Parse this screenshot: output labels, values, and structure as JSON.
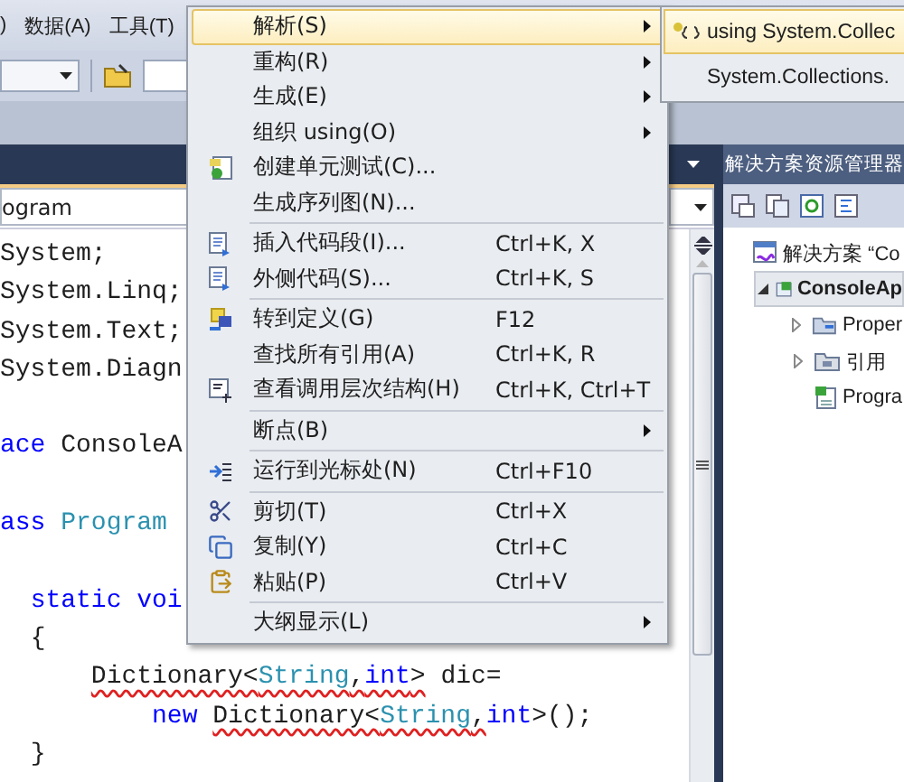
{
  "menu_bar": {
    "items": [
      ")",
      "数据(A)",
      "工具(T)"
    ]
  },
  "editor": {
    "type_dropdown": "ogram",
    "lines": [
      {
        "kind": "code",
        "tokens": [
          {
            "text": "System;",
            "kind": "plain"
          }
        ]
      },
      {
        "kind": "code",
        "tokens": [
          {
            "text": "System.Linq;",
            "kind": "plain"
          }
        ]
      },
      {
        "kind": "code",
        "tokens": [
          {
            "text": "System.Text;",
            "kind": "plain"
          }
        ]
      },
      {
        "kind": "code",
        "tokens": [
          {
            "text": "System.Diagn",
            "kind": "plain"
          }
        ]
      },
      {
        "kind": "blank"
      },
      {
        "kind": "code",
        "tokens": [
          {
            "text": "ace",
            "kind": "keyword"
          },
          {
            "text": " ConsoleA",
            "kind": "plain"
          }
        ]
      },
      {
        "kind": "blank"
      },
      {
        "kind": "code",
        "tokens": [
          {
            "text": "ass",
            "kind": "keyword"
          },
          {
            "text": " Program",
            "kind": "type"
          }
        ]
      },
      {
        "kind": "blank"
      },
      {
        "kind": "code",
        "tokens": [
          {
            "text": "  static voi",
            "kind": "keyword"
          }
        ]
      },
      {
        "kind": "code",
        "tokens": [
          {
            "text": "  {",
            "kind": "plain"
          }
        ]
      },
      {
        "kind": "code",
        "tokens": [
          {
            "text": "      Dictionary<",
            "kind": "plain",
            "error": true
          },
          {
            "text": "String",
            "kind": "type",
            "error": true
          },
          {
            "text": ",",
            "kind": "plain",
            "error": true
          },
          {
            "text": "int",
            "kind": "keyword",
            "error": true
          },
          {
            "text": ">",
            "kind": "plain",
            "error": true
          },
          {
            "text": " dic=",
            "kind": "plain"
          }
        ]
      },
      {
        "kind": "code",
        "tokens": [
          {
            "text": "          new",
            "kind": "keyword"
          },
          {
            "text": " Dictionary<",
            "kind": "plain",
            "error": true
          },
          {
            "text": "String",
            "kind": "type",
            "error": true
          },
          {
            "text": ",",
            "kind": "plain",
            "error": true
          },
          {
            "text": "int",
            "kind": "keyword"
          },
          {
            "text": ">();",
            "kind": "plain"
          }
        ]
      },
      {
        "kind": "code",
        "tokens": [
          {
            "text": "  }",
            "kind": "plain"
          }
        ]
      }
    ]
  },
  "solution_explorer": {
    "title": "解决方案资源管理器",
    "tree": [
      {
        "label": "解决方案 “Co",
        "kind": "solution",
        "selected": false,
        "children": [
          {
            "label": "ConsoleAp",
            "kind": "project",
            "selected": true,
            "expanded": true,
            "children": [
              {
                "label": "Proper",
                "kind": "properties",
                "selected": false,
                "expanded": false
              },
              {
                "label": "引用",
                "kind": "references",
                "selected": false,
                "expanded": false
              },
              {
                "label": "Progra",
                "kind": "file",
                "selected": false
              }
            ]
          }
        ]
      }
    ]
  },
  "context_menu": {
    "groups": [
      [
        {
          "label": "解析(S)",
          "submenu": true,
          "selected": true
        },
        {
          "label": "重构(R)",
          "submenu": true,
          "selected": false
        },
        {
          "label": "生成(E)",
          "submenu": true,
          "selected": false
        },
        {
          "label": "组织 using(O)",
          "submenu": true,
          "selected": false
        },
        {
          "label": "创建单元测试(C)...",
          "selected": false
        },
        {
          "label": "生成序列图(N)...",
          "selected": false
        }
      ],
      [
        {
          "label": "插入代码段(I)...",
          "shortcut": "Ctrl+K, X",
          "selected": false
        },
        {
          "label": "外侧代码(S)...",
          "shortcut": "Ctrl+K, S",
          "selected": false
        }
      ],
      [
        {
          "label": "转到定义(G)",
          "shortcut": "F12",
          "selected": false
        },
        {
          "label": "查找所有引用(A)",
          "shortcut": "Ctrl+K, R",
          "selected": false
        },
        {
          "label": "查看调用层次结构(H)",
          "shortcut": "Ctrl+K, Ctrl+T",
          "selected": false
        }
      ],
      [
        {
          "label": "断点(B)",
          "submenu": true,
          "selected": false
        }
      ],
      [
        {
          "label": "运行到光标处(N)",
          "shortcut": "Ctrl+F10",
          "selected": false
        }
      ],
      [
        {
          "label": "剪切(T)",
          "shortcut": "Ctrl+X",
          "selected": false
        },
        {
          "label": "复制(Y)",
          "shortcut": "Ctrl+C",
          "selected": false
        },
        {
          "label": "粘贴(P)",
          "shortcut": "Ctrl+V",
          "selected": false
        }
      ],
      [
        {
          "label": "大纲显示(L)",
          "submenu": true,
          "selected": false
        }
      ]
    ]
  },
  "submenu": {
    "items": [
      {
        "label": "using System.Collec",
        "selected": true
      },
      {
        "label": "System.Collections.",
        "selected": false
      }
    ]
  }
}
